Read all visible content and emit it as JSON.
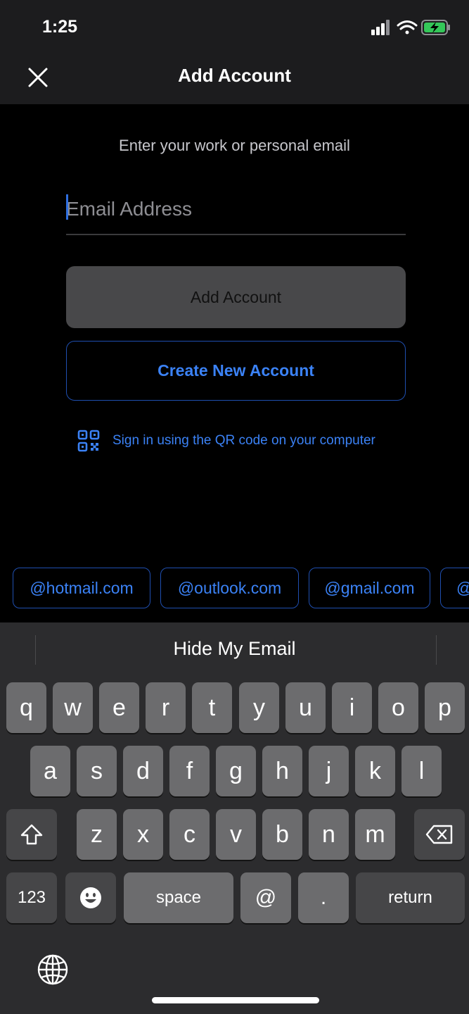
{
  "status_bar": {
    "time": "1:25"
  },
  "nav": {
    "title": "Add Account"
  },
  "form": {
    "prompt": "Enter your work or personal email",
    "email_placeholder": "Email Address",
    "email_value": "",
    "add_account_label": "Add Account",
    "create_account_label": "Create New Account",
    "qr_label": "Sign in using the QR code on your computer"
  },
  "domains": [
    "@hotmail.com",
    "@outlook.com",
    "@gmail.com",
    "@"
  ],
  "keyboard": {
    "suggestion": "Hide My Email",
    "row1": [
      "q",
      "w",
      "e",
      "r",
      "t",
      "y",
      "u",
      "i",
      "o",
      "p"
    ],
    "row2": [
      "a",
      "s",
      "d",
      "f",
      "g",
      "h",
      "j",
      "k",
      "l"
    ],
    "row3": [
      "z",
      "x",
      "c",
      "v",
      "b",
      "n",
      "m"
    ],
    "numbers_label": "123",
    "space_label": "space",
    "at_label": "@",
    "dot_label": ".",
    "return_label": "return"
  },
  "colors": {
    "accent": "#3b82f6",
    "chip_border": "#1f4fb0",
    "background": "#000000"
  },
  "icons": [
    "close-icon",
    "signal-icon",
    "wifi-icon",
    "battery-charging-icon",
    "qr-code-icon",
    "shift-icon",
    "backspace-icon",
    "emoji-icon",
    "globe-icon"
  ]
}
